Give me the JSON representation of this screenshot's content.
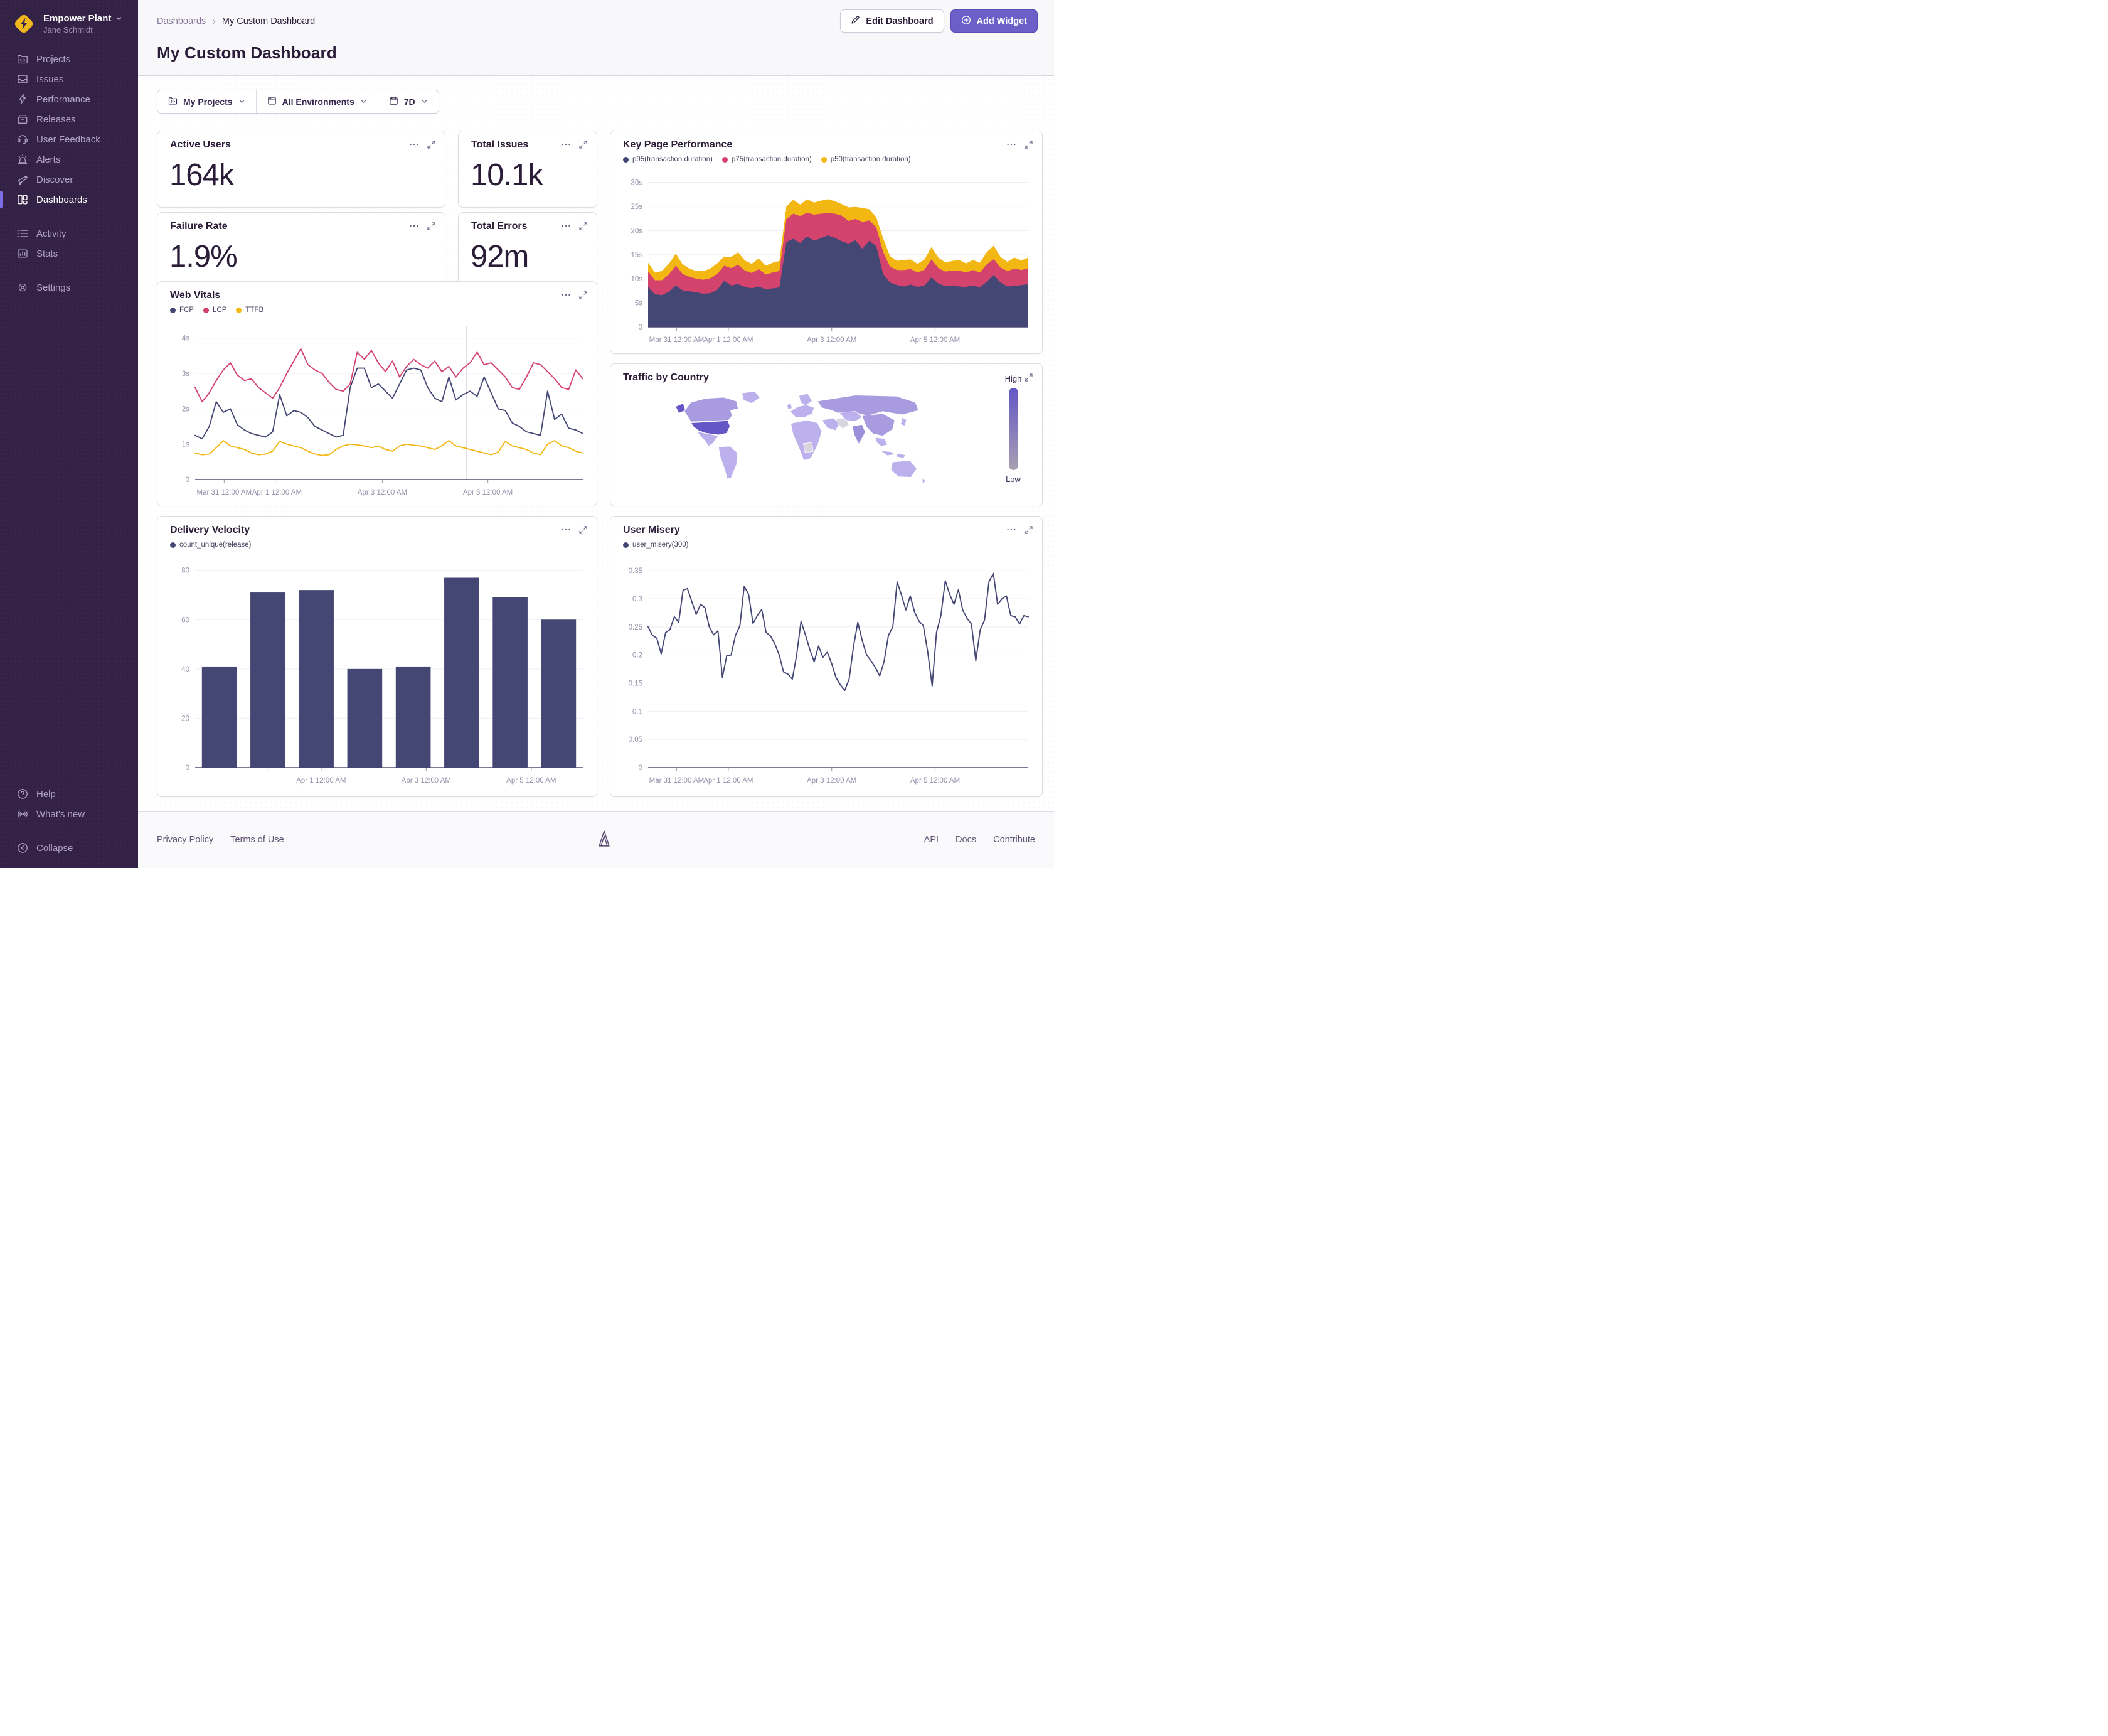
{
  "app": {
    "org_name": "Empower Plant",
    "user_name": "Jane Schmidt"
  },
  "sidebar": {
    "sections": [
      {
        "items": [
          {
            "label": "Projects",
            "icon": "projects"
          },
          {
            "label": "Issues",
            "icon": "issues"
          },
          {
            "label": "Performance",
            "icon": "performance"
          },
          {
            "label": "Releases",
            "icon": "releases"
          },
          {
            "label": "User Feedback",
            "icon": "user-feedback"
          },
          {
            "label": "Alerts",
            "icon": "alerts"
          },
          {
            "label": "Discover",
            "icon": "discover"
          },
          {
            "label": "Dashboards",
            "icon": "dashboards",
            "active": true
          }
        ]
      },
      {
        "items": [
          {
            "label": "Activity",
            "icon": "activity"
          },
          {
            "label": "Stats",
            "icon": "stats"
          }
        ]
      },
      {
        "items": [
          {
            "label": "Settings",
            "icon": "settings"
          }
        ]
      }
    ],
    "footer_sections": [
      {
        "items": [
          {
            "label": "Help",
            "icon": "help"
          },
          {
            "label": "What's new",
            "icon": "whats-new"
          }
        ]
      },
      {
        "items": [
          {
            "label": "Collapse",
            "icon": "collapse"
          }
        ]
      }
    ]
  },
  "header": {
    "breadcrumb": [
      "Dashboards",
      "My Custom Dashboard"
    ],
    "breadcrumb_separator": "›",
    "title": "My Custom Dashboard",
    "edit_button": "Edit Dashboard",
    "add_button": "Add Widget"
  },
  "filters": {
    "projects": "My Projects",
    "environments": "All Environments",
    "date_range": "7D"
  },
  "widgets": {
    "active_users": {
      "title": "Active Users",
      "value": "164k"
    },
    "total_issues": {
      "title": "Total Issues",
      "value": "10.1k"
    },
    "failure_rate": {
      "title": "Failure Rate",
      "value": "1.9%"
    },
    "total_errors": {
      "title": "Total Errors",
      "value": "92m"
    }
  },
  "footer": {
    "left_links": [
      "Privacy Policy",
      "Terms of Use"
    ],
    "right_links": [
      "API",
      "Docs",
      "Contribute"
    ]
  },
  "colors": {
    "accent": "#6c5fc7",
    "sidebar_bg": "#332146",
    "active_indicator": "#7d6ee4",
    "navy": "#444674",
    "pink": "#d4426e",
    "yellow": "#f2b712",
    "axis": "#6e6288",
    "grid": "#f1eef4",
    "tick_label": "#978ea9"
  },
  "chart_data": [
    {
      "id": "key-page-performance",
      "type": "area",
      "stacked": true,
      "title": "Key Page Performance",
      "ymax": 31.5,
      "yticks": [
        {
          "v": 0,
          "label": "0"
        },
        {
          "v": 5,
          "label": "5s"
        },
        {
          "v": 10,
          "label": "10s"
        },
        {
          "v": 15,
          "label": "15s"
        },
        {
          "v": 20,
          "label": "20s"
        },
        {
          "v": 25,
          "label": "25s"
        },
        {
          "v": 30,
          "label": "30s"
        }
      ],
      "xticks": [
        {
          "f": 0.075,
          "label": "Mar 31 12:00 AM"
        },
        {
          "f": 0.211,
          "label": "Apr 1 12:00 AM"
        },
        {
          "f": 0.483,
          "label": "Apr 3 12:00 AM"
        },
        {
          "f": 0.755,
          "label": "Apr 5 12:00 AM"
        }
      ],
      "series": [
        {
          "name": "p95(transaction.duration)",
          "color": "#444674",
          "values": [
            8.3,
            6.8,
            6.6,
            7.3,
            8.6,
            7.6,
            7.4,
            7.2,
            6.9,
            7.0,
            7.7,
            9.6,
            8.6,
            8.9,
            8.3,
            8.0,
            8.4,
            7.8,
            8.0,
            8.2,
            17.6,
            18.3,
            17.4,
            18.8,
            17.9,
            18.4,
            19.0,
            18.5,
            17.8,
            17.3,
            18.0,
            16.2,
            17.9,
            16.8,
            11.0,
            9.2,
            8.7,
            8.4,
            8.8,
            8.3,
            8.6,
            10.3,
            9.0,
            8.5,
            8.6,
            8.4,
            8.3,
            8.6,
            8.2,
            9.4,
            10.8,
            9.2,
            8.4,
            8.5,
            8.7,
            8.9
          ]
        },
        {
          "name": "p75(transaction.duration)",
          "color": "#d4426e",
          "values": [
            3.2,
            2.9,
            3.1,
            3.6,
            4.1,
            3.4,
            3.0,
            2.8,
            2.9,
            3.1,
            3.3,
            3.1,
            3.6,
            4.0,
            3.4,
            3.2,
            3.6,
            3.1,
            3.3,
            3.4,
            4.8,
            5.2,
            5.6,
            4.9,
            5.4,
            5.1,
            4.6,
            5.0,
            5.3,
            4.7,
            4.4,
            5.6,
            4.2,
            3.9,
            4.6,
            3.3,
            3.1,
            3.4,
            3.2,
            3.0,
            3.3,
            3.7,
            3.2,
            3.0,
            3.1,
            3.3,
            3.0,
            3.2,
            3.1,
            3.6,
            3.3,
            3.1,
            3.2,
            3.6,
            3.1,
            3.3
          ]
        },
        {
          "name": "p50(transaction.duration)",
          "color": "#f2b712",
          "values": [
            1.8,
            1.6,
            1.9,
            2.2,
            2.5,
            2.0,
            1.7,
            1.6,
            1.8,
            2.0,
            2.2,
            1.9,
            2.3,
            2.6,
            2.1,
            1.9,
            2.2,
            1.8,
            2.0,
            2.1,
            2.6,
            2.9,
            2.4,
            2.8,
            2.5,
            2.7,
            2.9,
            2.6,
            2.4,
            2.8,
            2.5,
            2.9,
            2.3,
            2.1,
            2.8,
            2.2,
            1.9,
            2.1,
            2.0,
            1.8,
            2.1,
            2.6,
            2.2,
            1.9,
            2.0,
            2.2,
            1.9,
            2.1,
            2.0,
            2.5,
            2.8,
            2.2,
            1.9,
            2.3,
            2.0,
            2.2
          ]
        }
      ]
    },
    {
      "id": "web-vitals",
      "type": "line",
      "title": "Web Vitals",
      "ymax": 4.35,
      "vline": 0.7,
      "yticks": [
        {
          "v": 0,
          "label": "0"
        },
        {
          "v": 1,
          "label": "1s"
        },
        {
          "v": 2,
          "label": "2s"
        },
        {
          "v": 3,
          "label": "3s"
        },
        {
          "v": 4,
          "label": "4s"
        }
      ],
      "xticks": [
        {
          "f": 0.075,
          "label": "Mar 31 12:00 AM"
        },
        {
          "f": 0.211,
          "label": "Apr 1 12:00 AM"
        },
        {
          "f": 0.483,
          "label": "Apr 3 12:00 AM"
        },
        {
          "f": 0.755,
          "label": "Apr 5 12:00 AM"
        }
      ],
      "series": [
        {
          "name": "FCP",
          "color": "#444674",
          "values": [
            1.25,
            1.15,
            1.5,
            2.2,
            1.9,
            2.0,
            1.55,
            1.4,
            1.3,
            1.25,
            1.2,
            1.35,
            2.4,
            1.8,
            1.95,
            1.9,
            1.75,
            1.5,
            1.4,
            1.3,
            1.2,
            1.25,
            2.6,
            3.15,
            3.15,
            2.6,
            2.7,
            2.5,
            2.3,
            2.7,
            3.1,
            3.15,
            3.1,
            2.6,
            2.3,
            2.2,
            2.9,
            2.25,
            2.4,
            2.5,
            2.35,
            2.9,
            2.45,
            2.0,
            1.95,
            1.6,
            1.5,
            1.35,
            1.3,
            1.25,
            2.5,
            1.7,
            1.85,
            1.45,
            1.4,
            1.3
          ]
        },
        {
          "name": "LCP",
          "color": "#d4426e",
          "values": [
            2.6,
            2.2,
            2.45,
            2.8,
            3.1,
            3.3,
            2.95,
            2.8,
            2.85,
            2.6,
            2.45,
            2.3,
            2.6,
            3.0,
            3.35,
            3.7,
            3.25,
            3.1,
            3.0,
            2.75,
            2.55,
            2.5,
            2.7,
            3.6,
            3.4,
            3.65,
            3.3,
            3.05,
            3.35,
            2.9,
            3.2,
            3.4,
            3.25,
            3.15,
            3.35,
            3.05,
            3.2,
            2.9,
            3.15,
            3.3,
            3.6,
            3.25,
            3.3,
            3.1,
            2.9,
            2.6,
            2.55,
            2.9,
            3.3,
            3.25,
            3.05,
            2.85,
            2.6,
            2.55,
            3.1,
            2.85
          ]
        },
        {
          "name": "TTFB",
          "color": "#f2b712",
          "values": [
            0.75,
            0.7,
            0.72,
            0.9,
            1.1,
            0.95,
            0.9,
            0.85,
            0.75,
            0.7,
            0.72,
            0.8,
            1.08,
            1.0,
            0.95,
            0.9,
            0.8,
            0.72,
            0.68,
            0.7,
            0.85,
            0.95,
            1.0,
            0.98,
            0.95,
            0.9,
            0.95,
            0.85,
            0.8,
            0.95,
            1.0,
            0.97,
            0.95,
            0.9,
            0.85,
            0.95,
            1.1,
            0.95,
            0.9,
            0.85,
            0.8,
            0.75,
            0.7,
            0.78,
            1.08,
            0.95,
            0.9,
            0.85,
            0.75,
            0.7,
            1.0,
            1.1,
            0.95,
            0.9,
            0.8,
            0.75
          ]
        }
      ]
    },
    {
      "id": "traffic-by-country",
      "type": "choropleth",
      "title": "Traffic by Country",
      "legend_high": "High",
      "legend_low": "Low",
      "highlight_country": "United States",
      "palette": {
        "high": "#6457c5",
        "low_gradient_end": "#a79fb2",
        "land": "#bcb1ec",
        "medium": "#a89bdf",
        "strong": "#9d90da",
        "muted": "#d9d5de",
        "border": "#ffffff"
      }
    },
    {
      "id": "delivery-velocity",
      "type": "bar",
      "title": "Delivery Velocity",
      "ymax": 84,
      "yticks": [
        {
          "v": 0,
          "label": "0"
        },
        {
          "v": 20,
          "label": "20"
        },
        {
          "v": 40,
          "label": "40"
        },
        {
          "v": 60,
          "label": "60"
        },
        {
          "v": 80,
          "label": "80"
        }
      ],
      "xticks": [
        {
          "f": 0.19,
          "label": ""
        },
        {
          "f": 0.325,
          "label": "Apr 1 12:00 AM"
        },
        {
          "f": 0.596,
          "label": "Apr 3 12:00 AM"
        },
        {
          "f": 0.867,
          "label": "Apr 5 12:00 AM"
        }
      ],
      "series": [
        {
          "name": "count_unique(release)",
          "color": "#444674",
          "values": [
            41,
            71,
            72,
            40,
            41,
            77,
            69,
            60
          ]
        }
      ]
    },
    {
      "id": "user-misery",
      "type": "line",
      "title": "User Misery",
      "ymax": 0.368,
      "yticks": [
        {
          "v": 0,
          "label": "0"
        },
        {
          "v": 0.05,
          "label": "0.05"
        },
        {
          "v": 0.1,
          "label": "0.1"
        },
        {
          "v": 0.15,
          "label": "0.15"
        },
        {
          "v": 0.2,
          "label": "0.2"
        },
        {
          "v": 0.25,
          "label": "0.25"
        },
        {
          "v": 0.3,
          "label": "0.3"
        },
        {
          "v": 0.35,
          "label": "0.35"
        }
      ],
      "xticks": [
        {
          "f": 0.075,
          "label": "Mar 31 12:00 AM"
        },
        {
          "f": 0.211,
          "label": "Apr 1 12:00 AM"
        },
        {
          "f": 0.483,
          "label": "Apr 3 12:00 AM"
        },
        {
          "f": 0.755,
          "label": "Apr 5 12:00 AM"
        }
      ],
      "series": [
        {
          "name": "user_misery(300)",
          "color": "#444674",
          "values": [
            0.25,
            0.235,
            0.23,
            0.202,
            0.24,
            0.245,
            0.268,
            0.258,
            0.315,
            0.318,
            0.295,
            0.272,
            0.29,
            0.284,
            0.25,
            0.236,
            0.243,
            0.16,
            0.199,
            0.2,
            0.235,
            0.252,
            0.322,
            0.308,
            0.256,
            0.27,
            0.281,
            0.24,
            0.234,
            0.22,
            0.2,
            0.17,
            0.166,
            0.157,
            0.2,
            0.26,
            0.236,
            0.21,
            0.188,
            0.216,
            0.196,
            0.205,
            0.185,
            0.16,
            0.147,
            0.137,
            0.157,
            0.215,
            0.258,
            0.226,
            0.2,
            0.19,
            0.178,
            0.163,
            0.188,
            0.235,
            0.25,
            0.33,
            0.306,
            0.28,
            0.305,
            0.276,
            0.26,
            0.252,
            0.205,
            0.145,
            0.24,
            0.27,
            0.332,
            0.308,
            0.29,
            0.316,
            0.28,
            0.265,
            0.255,
            0.19,
            0.245,
            0.262,
            0.33,
            0.345,
            0.29,
            0.3,
            0.305,
            0.27,
            0.268,
            0.255,
            0.27,
            0.268
          ]
        }
      ]
    }
  ]
}
